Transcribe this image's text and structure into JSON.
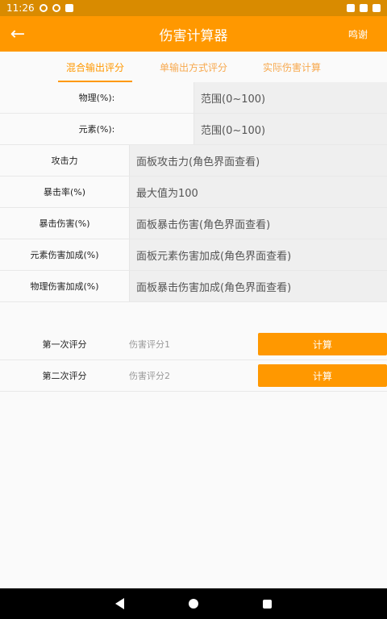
{
  "status_bar": {
    "time": "11:26"
  },
  "app_bar": {
    "back_icon": "arrow-left-icon",
    "title": "伤害计算器",
    "thanks": "鸣谢"
  },
  "tabs": [
    {
      "label": "混合输出评分",
      "active": true
    },
    {
      "label": "单输出方式评分",
      "active": false
    },
    {
      "label": "实际伤害计算",
      "active": false
    }
  ],
  "inputs": {
    "physical_ratio": {
      "label": "物理(%):",
      "placeholder": "范围(0~100)"
    },
    "element_ratio": {
      "label": "元素(%):",
      "placeholder": "范围(0~100)"
    },
    "attack": {
      "label": "攻击力",
      "placeholder": "面板攻击力(角色界面查看)"
    },
    "crit_rate": {
      "label": "暴击率(%)",
      "placeholder": "最大值为100"
    },
    "crit_damage": {
      "label": "暴击伤害(%)",
      "placeholder": "面板暴击伤害(角色界面查看)"
    },
    "elemental_bonus": {
      "label": "元素伤害加成(%)",
      "placeholder": "面板元素伤害加成(角色界面查看)"
    },
    "physical_bonus": {
      "label": "物理伤害加成(%)",
      "placeholder": "面板暴击伤害加成(角色界面查看)"
    }
  },
  "scores": [
    {
      "label": "第一次评分",
      "value": "伤害评分1",
      "button": "计算"
    },
    {
      "label": "第二次评分",
      "value": "伤害评分2",
      "button": "计算"
    }
  ],
  "colors": {
    "accent": "#ff9800",
    "status_bar": "#d98b00"
  }
}
